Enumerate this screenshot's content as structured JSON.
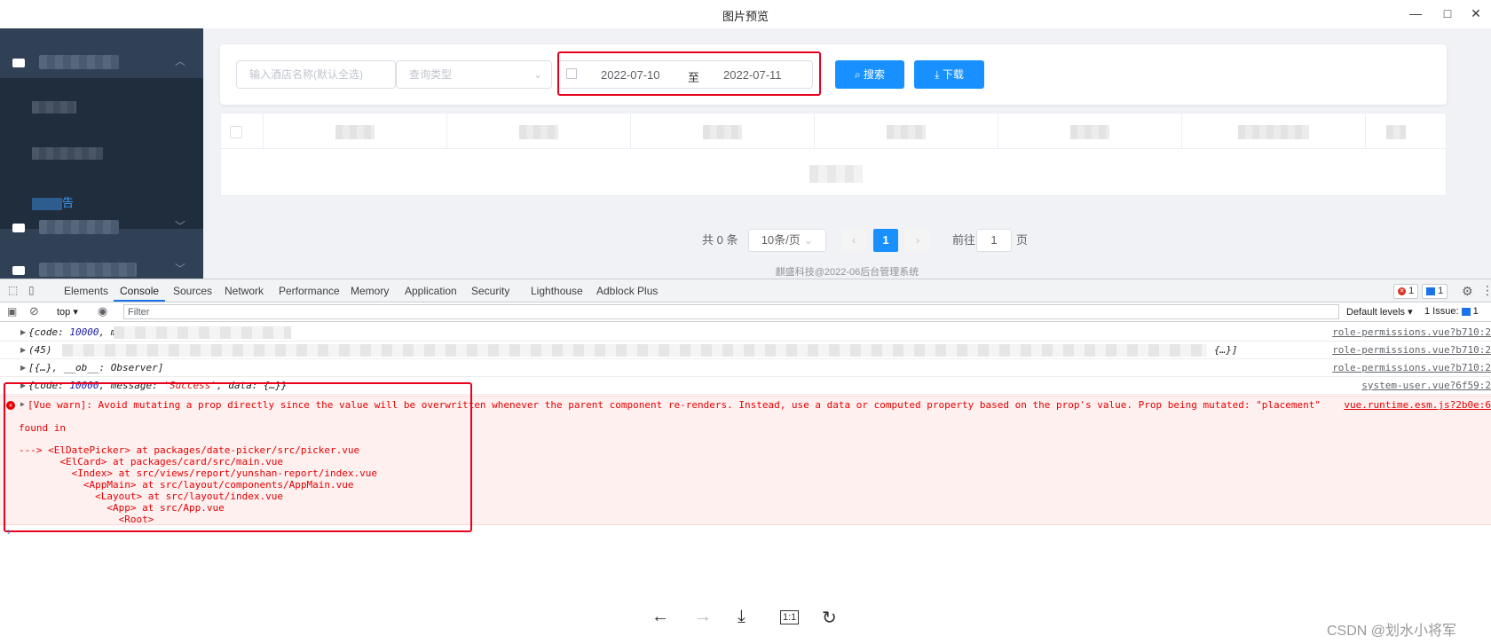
{
  "window": {
    "title": "图片预览",
    "minimize": "—",
    "maximize": "□",
    "close": "✕"
  },
  "search": {
    "hotel_placeholder": "输入酒店名称(默认全选)",
    "type_placeholder": "查询类型",
    "start_date": "2022-07-10",
    "range_separator": "至",
    "end_date": "2022-07-11",
    "search_label": "搜索",
    "download_label": "下载"
  },
  "sidebar": {
    "active_suffix": "告"
  },
  "pagination": {
    "total": "共 0 条",
    "page_size": "10条/页",
    "current_page": "1",
    "goto_label": "前往",
    "goto_value": "1",
    "page_unit": "页"
  },
  "footer": "麒盛科技@2022-06后台管理系统",
  "devtools": {
    "tabs": [
      "Elements",
      "Console",
      "Sources",
      "Network",
      "Performance",
      "Memory",
      "Application",
      "Security",
      "Lighthouse",
      "Adblock Plus"
    ],
    "active_tab": "Console",
    "error_count": "1",
    "message_count": "1",
    "context": "top",
    "filter_placeholder": "Filter",
    "default_levels": "Default levels",
    "issues": "1 Issue:",
    "issues_count": "1"
  },
  "console": {
    "rows": [
      {
        "text_prefix": "{code: ",
        "num": "10000",
        "text_suffix": ", m",
        "link": "role-permissions.vue?b710:2"
      },
      {
        "text_prefix": "(45)",
        "num": "",
        "text_suffix": "",
        "tail": "{…}]",
        "link": "role-permissions.vue?b710:2"
      },
      {
        "text_prefix": "[{…}, __ob__: Observer]",
        "num": "",
        "text_suffix": "",
        "link": "role-permissions.vue?b710:2"
      },
      {
        "text_prefix": "{code: ",
        "num": "10000",
        "text_mid": ", message: ",
        "str": "'Success'",
        "text_suffix": ", data: {…}}",
        "link": "system-user.vue?6f59:2"
      }
    ],
    "error": {
      "message": "[Vue warn]: Avoid mutating a prop directly since the value will be overwritten whenever the parent component re-renders. Instead, use a data or computed property based on the prop's value. Prop being mutated: \"placement\"",
      "link": "vue.runtime.esm.js?2b0e:6",
      "found_in": "found in",
      "trace": [
        "---> <ElDatePicker> at packages/date-picker/src/picker.vue",
        "       <ElCard> at packages/card/src/main.vue",
        "         <Index> at src/views/report/yunshan-report/index.vue",
        "           <AppMain> at src/layout/components/AppMain.vue",
        "             <Layout> at src/layout/index.vue",
        "               <App> at src/App.vue",
        "                 <Root>"
      ]
    },
    "prompt": "›"
  },
  "viewer": {
    "prev": "←",
    "next": "→",
    "download": "⤓",
    "actual_size": "1:1",
    "rotate": "↻"
  },
  "watermark": "CSDN @划水小将军",
  "colors": {
    "primary": "#1890ff",
    "sidebar": "#304156",
    "highlight": "#e8001c",
    "error": "#e50000"
  }
}
